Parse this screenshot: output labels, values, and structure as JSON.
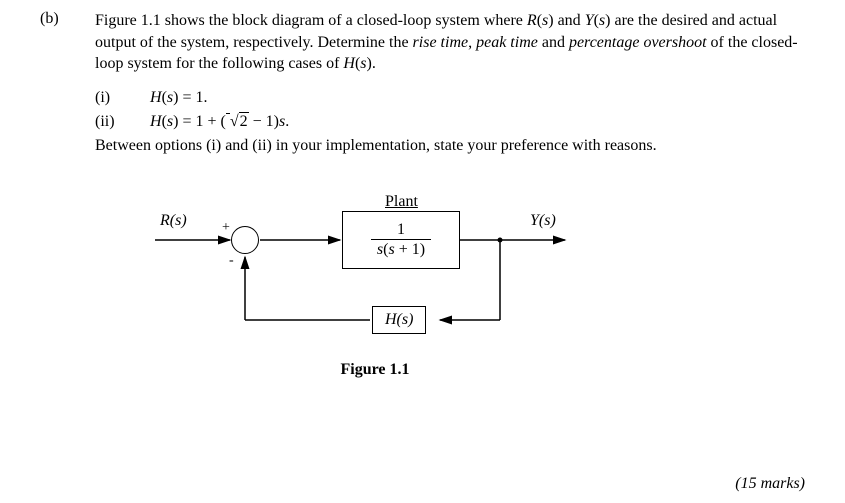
{
  "part_label": "(b)",
  "intro_segments": {
    "s1": "Figure 1.1 shows the block diagram of a closed-loop system where ",
    "rs": "R",
    "paren_s1": "(",
    "svar1": "s",
    "paren_e1": ")",
    "and": " and ",
    "ys": "Y",
    "paren_s2": "(",
    "svar2": "s",
    "paren_e2": ")",
    "s2": " are the desired and actual output of the system, respectively. Determine the ",
    "rise": "rise time",
    "comma": ", ",
    "peak": "peak time",
    "and2": " and ",
    "ov": "percentage overshoot",
    "s3": " of the closed-loop system for the following cases of ",
    "hs": "H",
    "paren_s3": "(",
    "svar3": "s",
    "paren_e3": ")",
    "dot": "."
  },
  "items": {
    "i": {
      "num": "(i)",
      "prefix": "H",
      "open": "(",
      "s": "s",
      "close": ")",
      "eq": " = 1."
    },
    "ii": {
      "num": "(ii)",
      "prefix": "H",
      "open": "(",
      "s": "s",
      "close": ")",
      "eq_a": " = 1 + (",
      "sqrt": "√2",
      "eq_b": " − 1)",
      "s2": "s",
      "dot": "."
    }
  },
  "followup": "Between options (i) and (ii) in your implementation, state your preference with reasons.",
  "diagram": {
    "r_label": "R(s)",
    "y_label": "Y(s)",
    "plant_label": "Plant",
    "plant_num": "1",
    "plant_den": "s(s + 1)",
    "h_label": "H(s)",
    "plus": "+",
    "minus": "-"
  },
  "caption": "Figure 1.1",
  "marks": "(15 marks)"
}
